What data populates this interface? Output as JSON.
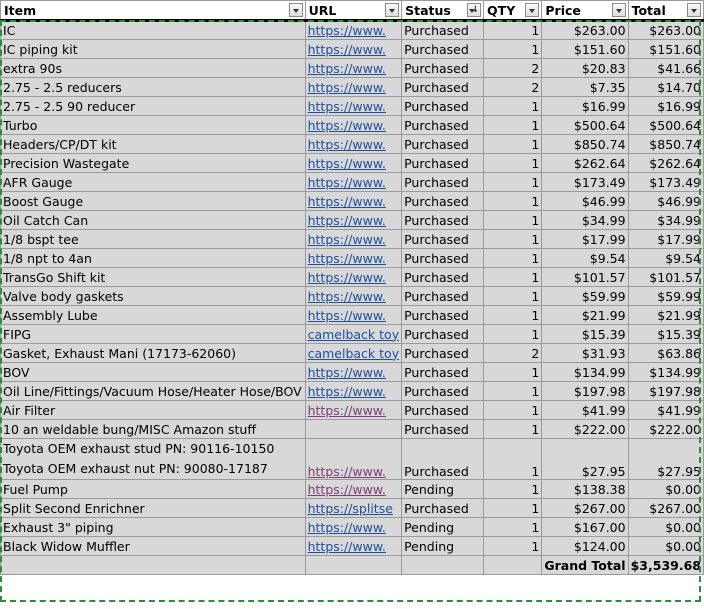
{
  "headers": [
    "Item",
    "URL",
    "Status",
    "QTY",
    "Price",
    "Total"
  ],
  "rows": [
    {
      "item": "IC",
      "url": "https://www.",
      "status": "Purchased",
      "qty": "1",
      "price": "$263.00",
      "total": "$263.00"
    },
    {
      "item": "IC piping kit",
      "url": "https://www.",
      "status": "Purchased",
      "qty": "1",
      "price": "$151.60",
      "total": "$151.60"
    },
    {
      "item": "extra 90s",
      "url": "https://www.",
      "status": "Purchased",
      "qty": "2",
      "price": "$20.83",
      "total": "$41.66"
    },
    {
      "item": "2.75 - 2.5 reducers",
      "url": "https://www.",
      "status": "Purchased",
      "qty": "2",
      "price": "$7.35",
      "total": "$14.70"
    },
    {
      "item": "2.75 - 2.5 90 reducer",
      "url": "https://www.",
      "status": "Purchased",
      "qty": "1",
      "price": "$16.99",
      "total": "$16.99"
    },
    {
      "item": "Turbo",
      "url": "https://www.",
      "status": "Purchased",
      "qty": "1",
      "price": "$500.64",
      "total": "$500.64"
    },
    {
      "item": "Headers/CP/DT kit",
      "url": "https://www.",
      "status": "Purchased",
      "qty": "1",
      "price": "$850.74",
      "total": "$850.74"
    },
    {
      "item": "Precision Wastegate",
      "url": "https://www.",
      "status": "Purchased",
      "qty": "1",
      "price": "$262.64",
      "total": "$262.64"
    },
    {
      "item": "AFR Gauge",
      "url": "https://www.",
      "status": "Purchased",
      "qty": "1",
      "price": "$173.49",
      "total": "$173.49"
    },
    {
      "item": "Boost Gauge",
      "url": "https://www.",
      "status": "Purchased",
      "qty": "1",
      "price": "$46.99",
      "total": "$46.99"
    },
    {
      "item": "Oil Catch Can",
      "url": "https://www.",
      "status": "Purchased",
      "qty": "1",
      "price": "$34.99",
      "total": "$34.99"
    },
    {
      "item": "1/8 bspt tee",
      "url": "https://www.",
      "status": "Purchased",
      "qty": "1",
      "price": "$17.99",
      "total": "$17.99"
    },
    {
      "item": "1/8 npt to 4an",
      "url": "https://www.",
      "status": "Purchased",
      "qty": "1",
      "price": "$9.54",
      "total": "$9.54"
    },
    {
      "item": "TransGo Shift kit",
      "url": "https://www.",
      "status": "Purchased",
      "qty": "1",
      "price": "$101.57",
      "total": "$101.57"
    },
    {
      "item": "Valve body gaskets",
      "url": "https://www.",
      "status": "Purchased",
      "qty": "1",
      "price": "$59.99",
      "total": "$59.99"
    },
    {
      "item": "Assembly Lube",
      "url": "https://www.",
      "status": "Purchased",
      "qty": "1",
      "price": "$21.99",
      "total": "$21.99"
    },
    {
      "item": "FIPG",
      "url": "camelback toy",
      "status": "Purchased",
      "qty": "1",
      "price": "$15.39",
      "total": "$15.39"
    },
    {
      "item": "Gasket, Exhaust Mani (17173-62060)",
      "url": "camelback toy",
      "status": "Purchased",
      "qty": "2",
      "price": "$31.93",
      "total": "$63.86"
    },
    {
      "item": "BOV",
      "url": "https://www.",
      "status": "Purchased",
      "qty": "1",
      "price": "$134.99",
      "total": "$134.99"
    },
    {
      "item": "Oil Line/Fittings/Vacuum Hose/Heater Hose/BOV",
      "url": "https://www.",
      "status": "Purchased",
      "qty": "1",
      "price": "$197.98",
      "total": "$197.98"
    },
    {
      "item": "Air Filter",
      "url": "https://www.",
      "status": "Purchased",
      "qty": "1",
      "price": "$41.99",
      "total": "$41.99",
      "visited": true
    },
    {
      "item": "10 an weldable bung/MISC Amazon stuff",
      "url": "",
      "status": "Purchased",
      "qty": "1",
      "price": "$222.00",
      "total": "$222.00"
    },
    {
      "item": "Toyota OEM exhaust stud PN: 90116-10150\nToyota OEM exhaust nut PN: 90080-17187",
      "url": "https://www.",
      "status": "Purchased",
      "qty": "1",
      "price": "$27.95",
      "total": "$27.95",
      "visited": true,
      "tall": true
    },
    {
      "item": "Fuel Pump",
      "url": "https://www.",
      "status": "Pending",
      "qty": "1",
      "price": "$138.38",
      "total": "$0.00",
      "visited": true
    },
    {
      "item": "Split Second Enrichner",
      "url": "https://splitse",
      "status": "Purchased",
      "qty": "1",
      "price": "$267.00",
      "total": "$267.00"
    },
    {
      "item": "Exhaust 3\" piping",
      "url": "https://www.",
      "status": "Pending",
      "qty": "1",
      "price": "$167.00",
      "total": "$0.00"
    },
    {
      "item": "Black Widow Muffler",
      "url": "https://www.",
      "status": "Pending",
      "qty": "1",
      "price": "$124.00",
      "total": "$0.00"
    }
  ],
  "footer": {
    "label": "Grand Total",
    "value": "$3,539.68"
  },
  "colors": {
    "link": "#1f4f9b",
    "visited_link": "#7a3f77",
    "selection": "#2e8b3e",
    "cell_fill": "#d8d8d8"
  }
}
